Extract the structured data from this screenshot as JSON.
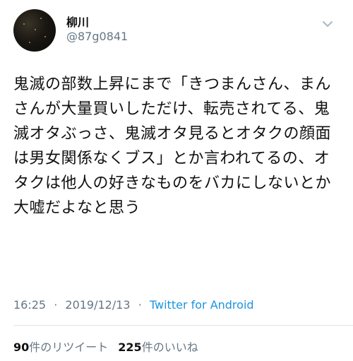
{
  "user": {
    "display_name": "柳川",
    "handle": "@87g0841",
    "avatar_icon": "avatar-image"
  },
  "tweet": {
    "text": "鬼滅の部数上昇にまで「きつまんさん、まんさんが大量買いしただけ、転売されてる、鬼滅オタぶっさ、鬼滅オタ見るとオタクの顔面は男女関係なくブス」とか言われてるの、オタクは他人の好きなものをバカにしないとか大嘘だよなと思う"
  },
  "meta": {
    "time": "16:25",
    "separator": "·",
    "date": "2019/12/13",
    "source": "Twitter for Android"
  },
  "stats": {
    "retweets_count": "90",
    "retweets_label": "件のリツイート",
    "likes_count": "225",
    "likes_label": "件のいいね"
  },
  "colors": {
    "secondary_text": "#657786",
    "link": "#1b95e0",
    "divider": "#dfe3e6"
  },
  "icons": {
    "more": "chevron-down-icon"
  }
}
